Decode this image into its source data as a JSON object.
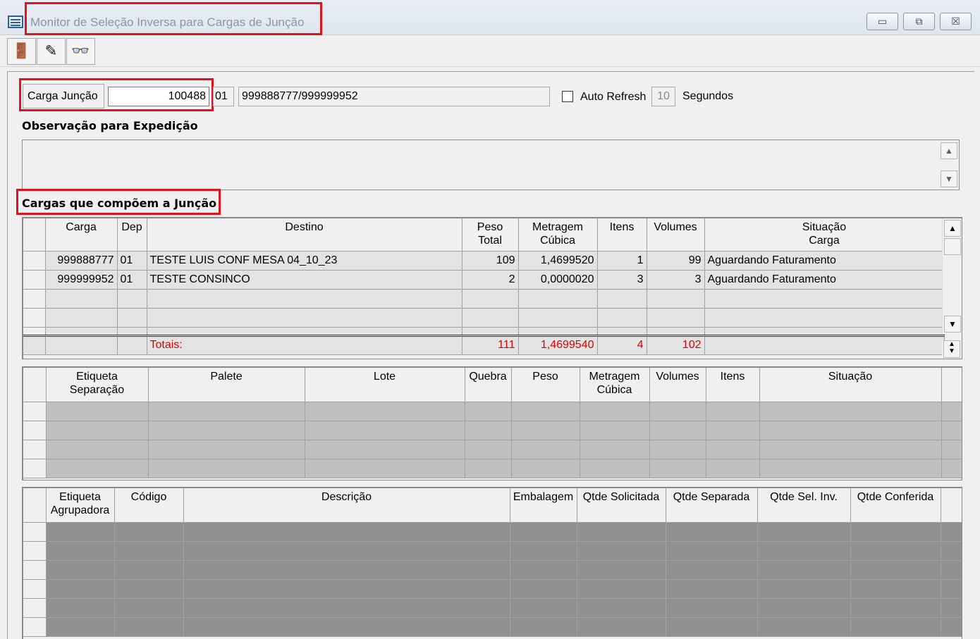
{
  "window": {
    "title": "Monitor de Seleção Inversa para Cargas de Junção",
    "minimize_glyph": "▭",
    "maximize_glyph": "⧉",
    "close_glyph": "☒"
  },
  "toolbar": {
    "buttons": [
      {
        "name": "exit-icon",
        "glyph": "🚪"
      },
      {
        "name": "eraser-icon",
        "glyph": "✎"
      },
      {
        "name": "binoculars-icon",
        "glyph": "👓"
      }
    ]
  },
  "header": {
    "carga_juncao_label": "Carga Junção",
    "carga_juncao_value": "100488",
    "deposito_value": "01",
    "cargas_value": "999888777/999999952",
    "auto_refresh_label": "Auto Refresh",
    "auto_refresh_checked": false,
    "refresh_seconds": "10",
    "seconds_label": "Segundos"
  },
  "observacao": {
    "title": "Observação para Expedição",
    "text": ""
  },
  "cargas": {
    "title": "Cargas que compõem a Junção",
    "columns": [
      [
        "Carga"
      ],
      [
        "Dep"
      ],
      [
        "Destino"
      ],
      [
        "Peso",
        "Total"
      ],
      [
        "Metragem",
        "Cúbica"
      ],
      [
        "Itens"
      ],
      [
        "Volumes"
      ],
      [
        "Situação",
        "Carga"
      ]
    ],
    "rows": [
      {
        "carga": "999888777",
        "dep": "01",
        "destino": "TESTE LUIS CONF MESA 04_10_23",
        "peso": "109",
        "metragem": "1,4699520",
        "itens": "1",
        "volumes": "99",
        "situacao": "Aguardando Faturamento"
      },
      {
        "carga": "999999952",
        "dep": "01",
        "destino": "TESTE CONSINCO",
        "peso": "2",
        "metragem": "0,0000020",
        "itens": "3",
        "volumes": "3",
        "situacao": "Aguardando Faturamento"
      }
    ],
    "totals": {
      "label": "Totais:",
      "peso": "111",
      "metragem": "1,4699540",
      "itens": "4",
      "volumes": "102"
    }
  },
  "etiquetas": {
    "columns": [
      [
        "Etiqueta",
        "Separação"
      ],
      [
        "Palete"
      ],
      [
        "Lote"
      ],
      [
        "Quebra"
      ],
      [
        "Peso"
      ],
      [
        "Metragem",
        "Cúbica"
      ],
      [
        "Volumes"
      ],
      [
        "Itens"
      ],
      [
        "Situação"
      ]
    ]
  },
  "produtos": {
    "columns": [
      [
        "Etiqueta",
        "Agrupadora"
      ],
      [
        "Código"
      ],
      [
        "Descrição"
      ],
      [
        "Embalagem"
      ],
      [
        "Qtde Solicitada"
      ],
      [
        "Qtde Separada"
      ],
      [
        "Qtde Sel. Inv."
      ],
      [
        "Qtde Conferida"
      ]
    ]
  }
}
